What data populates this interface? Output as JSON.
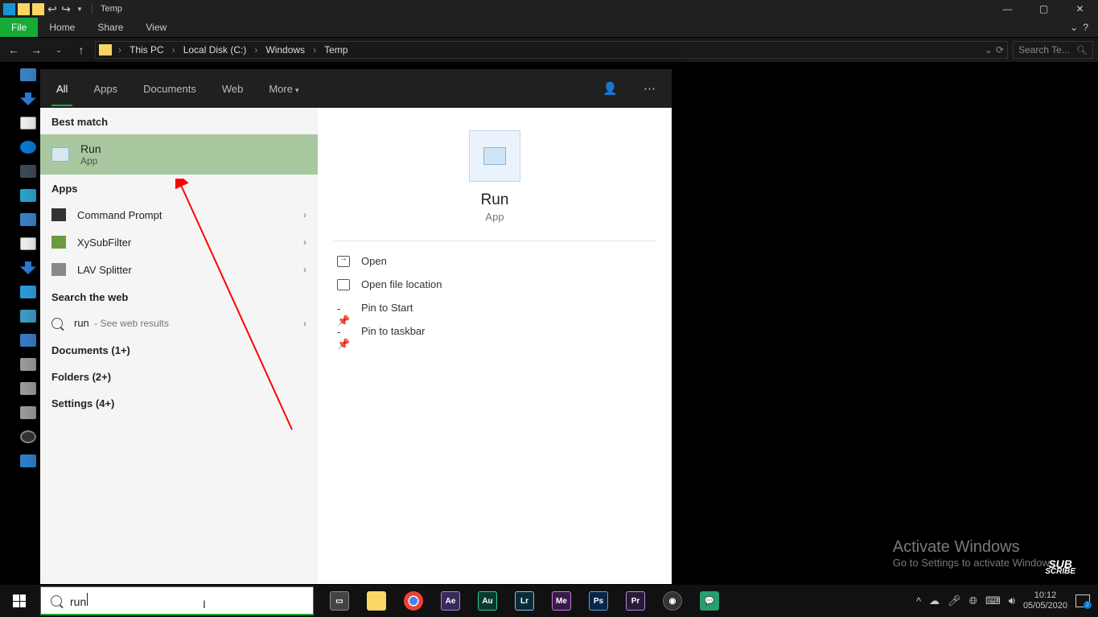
{
  "titlebar": {
    "title": "Temp"
  },
  "ribbon": {
    "file": "File",
    "home": "Home",
    "share": "Share",
    "view": "View"
  },
  "breadcrumb": {
    "root": "This PC",
    "c": "Local Disk (C:)",
    "win": "Windows",
    "temp": "Temp"
  },
  "searchbox_placeholder": "Search Te...",
  "sp": {
    "tabs": {
      "all": "All",
      "apps": "Apps",
      "documents": "Documents",
      "web": "Web",
      "more": "More"
    },
    "best_match_label": "Best match",
    "best": {
      "title": "Run",
      "type": "App"
    },
    "apps_label": "Apps",
    "apps": [
      {
        "name": "Command Prompt"
      },
      {
        "name": "XySubFilter"
      },
      {
        "name": "LAV Splitter"
      }
    ],
    "web_label": "Search the web",
    "web_item": {
      "q": "run",
      "tail": " - See web results"
    },
    "documents_label": "Documents (1+)",
    "folders_label": "Folders (2+)",
    "settings_label": "Settings (4+)",
    "detail": {
      "title": "Run",
      "type": "App"
    },
    "actions": {
      "open": "Open",
      "openloc": "Open file location",
      "pinstart": "Pin to Start",
      "pintaskbar": "Pin to taskbar"
    }
  },
  "activate": {
    "l1": "Activate Windows",
    "l2": "Go to Settings to activate Windows."
  },
  "taskbar": {
    "search_value": "run",
    "time": "10:12",
    "date": "05/05/2020",
    "notif_count": "2"
  },
  "apps_colors": {
    "taskview": "#444",
    "explorer": "#fad664",
    "chrome": "#fff",
    "ae": "#3a2a5a",
    "au": "#083b2f",
    "lr": "#0b2b3a",
    "me": "#3a1a4a",
    "ps": "#0b264a",
    "pr": "#2a1a3a",
    "obs": "#333",
    "chat": "#2a9d6f"
  },
  "subscribe": {
    "t1": "SUB",
    "t2": "SCRIBE"
  }
}
